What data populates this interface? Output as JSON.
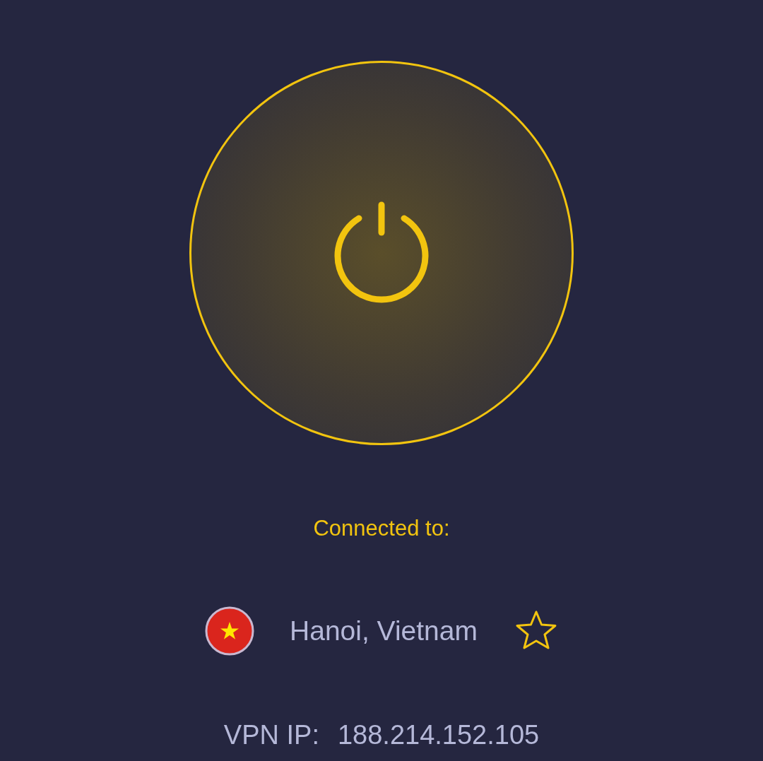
{
  "power_button": {
    "connected": true
  },
  "status_label": "Connected to:",
  "location": {
    "name": "Hanoi, Vietnam",
    "favorite": false
  },
  "vpn_ip": {
    "label": "VPN IP:",
    "value": "188.214.152.105"
  }
}
